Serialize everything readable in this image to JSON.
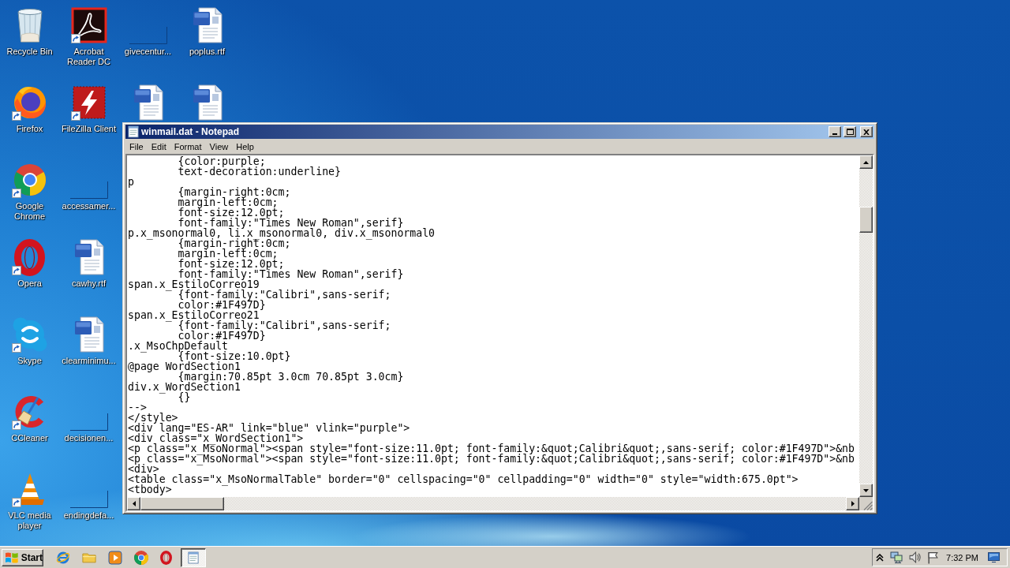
{
  "desktop": {
    "columns": [
      {
        "icons": [
          {
            "label": "Recycle Bin",
            "kind": "recycle-bin",
            "shortcut": false
          },
          {
            "label": "Firefox",
            "kind": "firefox",
            "shortcut": true
          },
          {
            "label": "Google Chrome",
            "kind": "chrome",
            "shortcut": true
          },
          {
            "label": "Opera",
            "kind": "opera",
            "shortcut": true
          },
          {
            "label": "Skype",
            "kind": "skype",
            "shortcut": true
          },
          {
            "label": "CCleaner",
            "kind": "ccleaner",
            "shortcut": true
          },
          {
            "label": "VLC media player",
            "kind": "vlc",
            "shortcut": true
          }
        ]
      },
      {
        "icons": [
          {
            "label": "Acrobat Reader DC",
            "kind": "acrobat",
            "shortcut": true
          },
          {
            "label": "FileZilla Client",
            "kind": "filezilla",
            "shortcut": true
          },
          {
            "label": "accessamer...",
            "kind": "blank",
            "shortcut": false
          },
          {
            "label": "cawhy.rtf",
            "kind": "word",
            "shortcut": false
          },
          {
            "label": "clearminimu...",
            "kind": "word",
            "shortcut": false
          },
          {
            "label": "decisionen...",
            "kind": "blank",
            "shortcut": false
          },
          {
            "label": "endingdefa...",
            "kind": "blank",
            "shortcut": false
          }
        ]
      },
      {
        "icons": [
          {
            "label": "givecentur...",
            "kind": "blank",
            "shortcut": false
          },
          {
            "kind": "word",
            "shortcut": false
          }
        ]
      },
      {
        "icons": [
          {
            "label": "poplus.rtf",
            "kind": "word",
            "shortcut": false
          },
          {
            "kind": "word",
            "shortcut": false
          }
        ]
      }
    ]
  },
  "window": {
    "title": "winmail.dat - Notepad",
    "buttons": [
      {
        "kind": "minimize"
      },
      {
        "kind": "maximize"
      },
      {
        "kind": "close"
      }
    ],
    "menu": [
      "File",
      "Edit",
      "Format",
      "View",
      "Help"
    ],
    "lines": [
      "\t{color:purple;",
      "\ttext-decoration:underline}",
      "p",
      "\t{margin-right:0cm;",
      "\tmargin-left:0cm;",
      "\tfont-size:12.0pt;",
      "\tfont-family:\"Times New Roman\",serif}",
      "p.x_msonormal0, li.x_msonormal0, div.x_msonormal0",
      "\t{margin-right:0cm;",
      "\tmargin-left:0cm;",
      "\tfont-size:12.0pt;",
      "\tfont-family:\"Times New Roman\",serif}",
      "span.x_EstiloCorreo19",
      "\t{font-family:\"Calibri\",sans-serif;",
      "\tcolor:#1F497D}",
      "span.x_EstiloCorreo21",
      "\t{font-family:\"Calibri\",sans-serif;",
      "\tcolor:#1F497D}",
      ".x_MsoChpDefault",
      "\t{font-size:10.0pt}",
      "@page WordSection1",
      "\t{margin:70.85pt 3.0cm 70.85pt 3.0cm}",
      "div.x_WordSection1",
      "\t{}",
      "-->",
      "</style>",
      "<div lang=\"ES-AR\" link=\"blue\" vlink=\"purple\">",
      "<div class=\"x_WordSection1\">",
      "<p class=\"x_MsoNormal\"><span style=\"font-size:11.0pt; font-family:&quot;Calibri&quot;,sans-serif; color:#1F497D\">&nb",
      "<p class=\"x_MsoNormal\"><span style=\"font-size:11.0pt; font-family:&quot;Calibri&quot;,sans-serif; color:#1F497D\">&nb",
      "<div>",
      "<table class=\"x_MsoNormalTable\" border=\"0\" cellspacing=\"0\" cellpadding=\"0\" width=\"0\" style=\"width:675.0pt\">",
      "<tbody>"
    ]
  },
  "taskbar": {
    "start": "Start",
    "quick_launch": [
      {
        "kind": "internet-explorer"
      },
      {
        "kind": "folder"
      },
      {
        "kind": "media-player"
      },
      {
        "kind": "chrome"
      },
      {
        "kind": "opera"
      }
    ],
    "tasks": [
      {
        "kind": "notepad",
        "selected": true
      }
    ],
    "tray": [
      {
        "kind": "chevron"
      },
      {
        "kind": "network"
      },
      {
        "kind": "speaker"
      },
      {
        "kind": "flag"
      }
    ],
    "clock": "7:32 PM"
  }
}
